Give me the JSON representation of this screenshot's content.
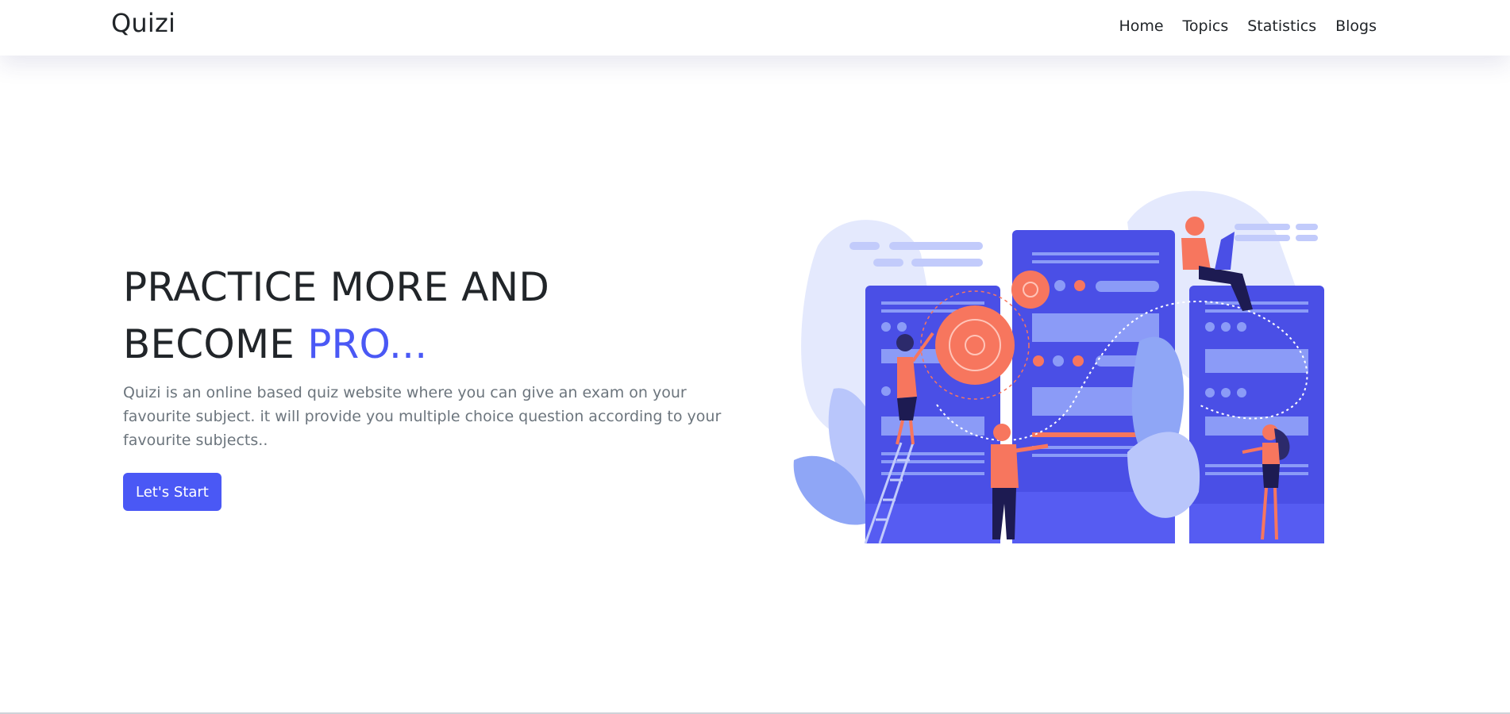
{
  "navbar": {
    "brand": "Quizi",
    "links": [
      "Home",
      "Topics",
      "Statistics",
      "Blogs"
    ]
  },
  "hero": {
    "title_line1": "PRACTICE MORE AND",
    "title_line2": "BECOME ",
    "title_accent": "PRO...",
    "description": "Quizi is an online based quiz website where you can give an exam on your favourite subject. it will provide you multiple choice question according to your favourite subjects..",
    "cta_label": "Let's Start"
  },
  "colors": {
    "accent": "#4a58f5",
    "text_dark": "#212529",
    "text_muted": "#6c757d",
    "server": "#4a4fe6",
    "coral": "#f7765e",
    "pale": "#e2e7fd"
  }
}
